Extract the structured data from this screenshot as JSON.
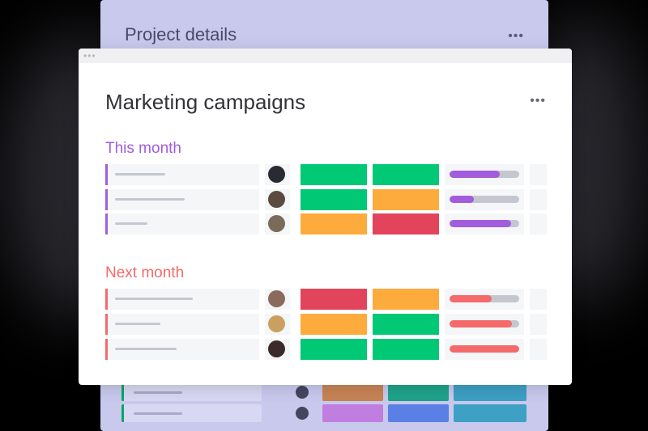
{
  "colors": {
    "purple": "#a25ddc",
    "salmon": "#f46a6a",
    "green": "#00c875",
    "orange": "#fdab3d",
    "red": "#e2445c",
    "back_green": "#00a86b"
  },
  "back_board": {
    "title": "Project details",
    "menu": "•••",
    "rows": [
      {
        "status": [
          "#c88456",
          "#1fa38b",
          "#3da0c4"
        ]
      },
      {
        "status": [
          "#c07ee0",
          "#5a80e6",
          "#3da0c4"
        ]
      }
    ]
  },
  "card": {
    "window_dots": "•••",
    "title": "Marketing campaigns",
    "menu": "•••",
    "groups": [
      {
        "title": "This month",
        "color": "#a25ddc",
        "rows": [
          {
            "avatar": "#2a2a33",
            "status": [
              "#00c875",
              "#00c875"
            ],
            "progress": 0.72
          },
          {
            "avatar": "#5a4a40",
            "status": [
              "#00c875",
              "#fdab3d"
            ],
            "progress": 0.35
          },
          {
            "avatar": "#7a6a5a",
            "status": [
              "#fdab3d",
              "#e2445c"
            ],
            "progress": 0.88
          }
        ]
      },
      {
        "title": "Next month",
        "color": "#f46a6a",
        "rows": [
          {
            "avatar": "#8a6a5a",
            "status": [
              "#e2445c",
              "#fdab3d"
            ],
            "progress": 0.6
          },
          {
            "avatar": "#c9a060",
            "status": [
              "#fdab3d",
              "#00c875"
            ],
            "progress": 0.9
          },
          {
            "avatar": "#3a2a2a",
            "status": [
              "#00c875",
              "#00c875"
            ],
            "progress": 1.0
          }
        ]
      }
    ]
  }
}
